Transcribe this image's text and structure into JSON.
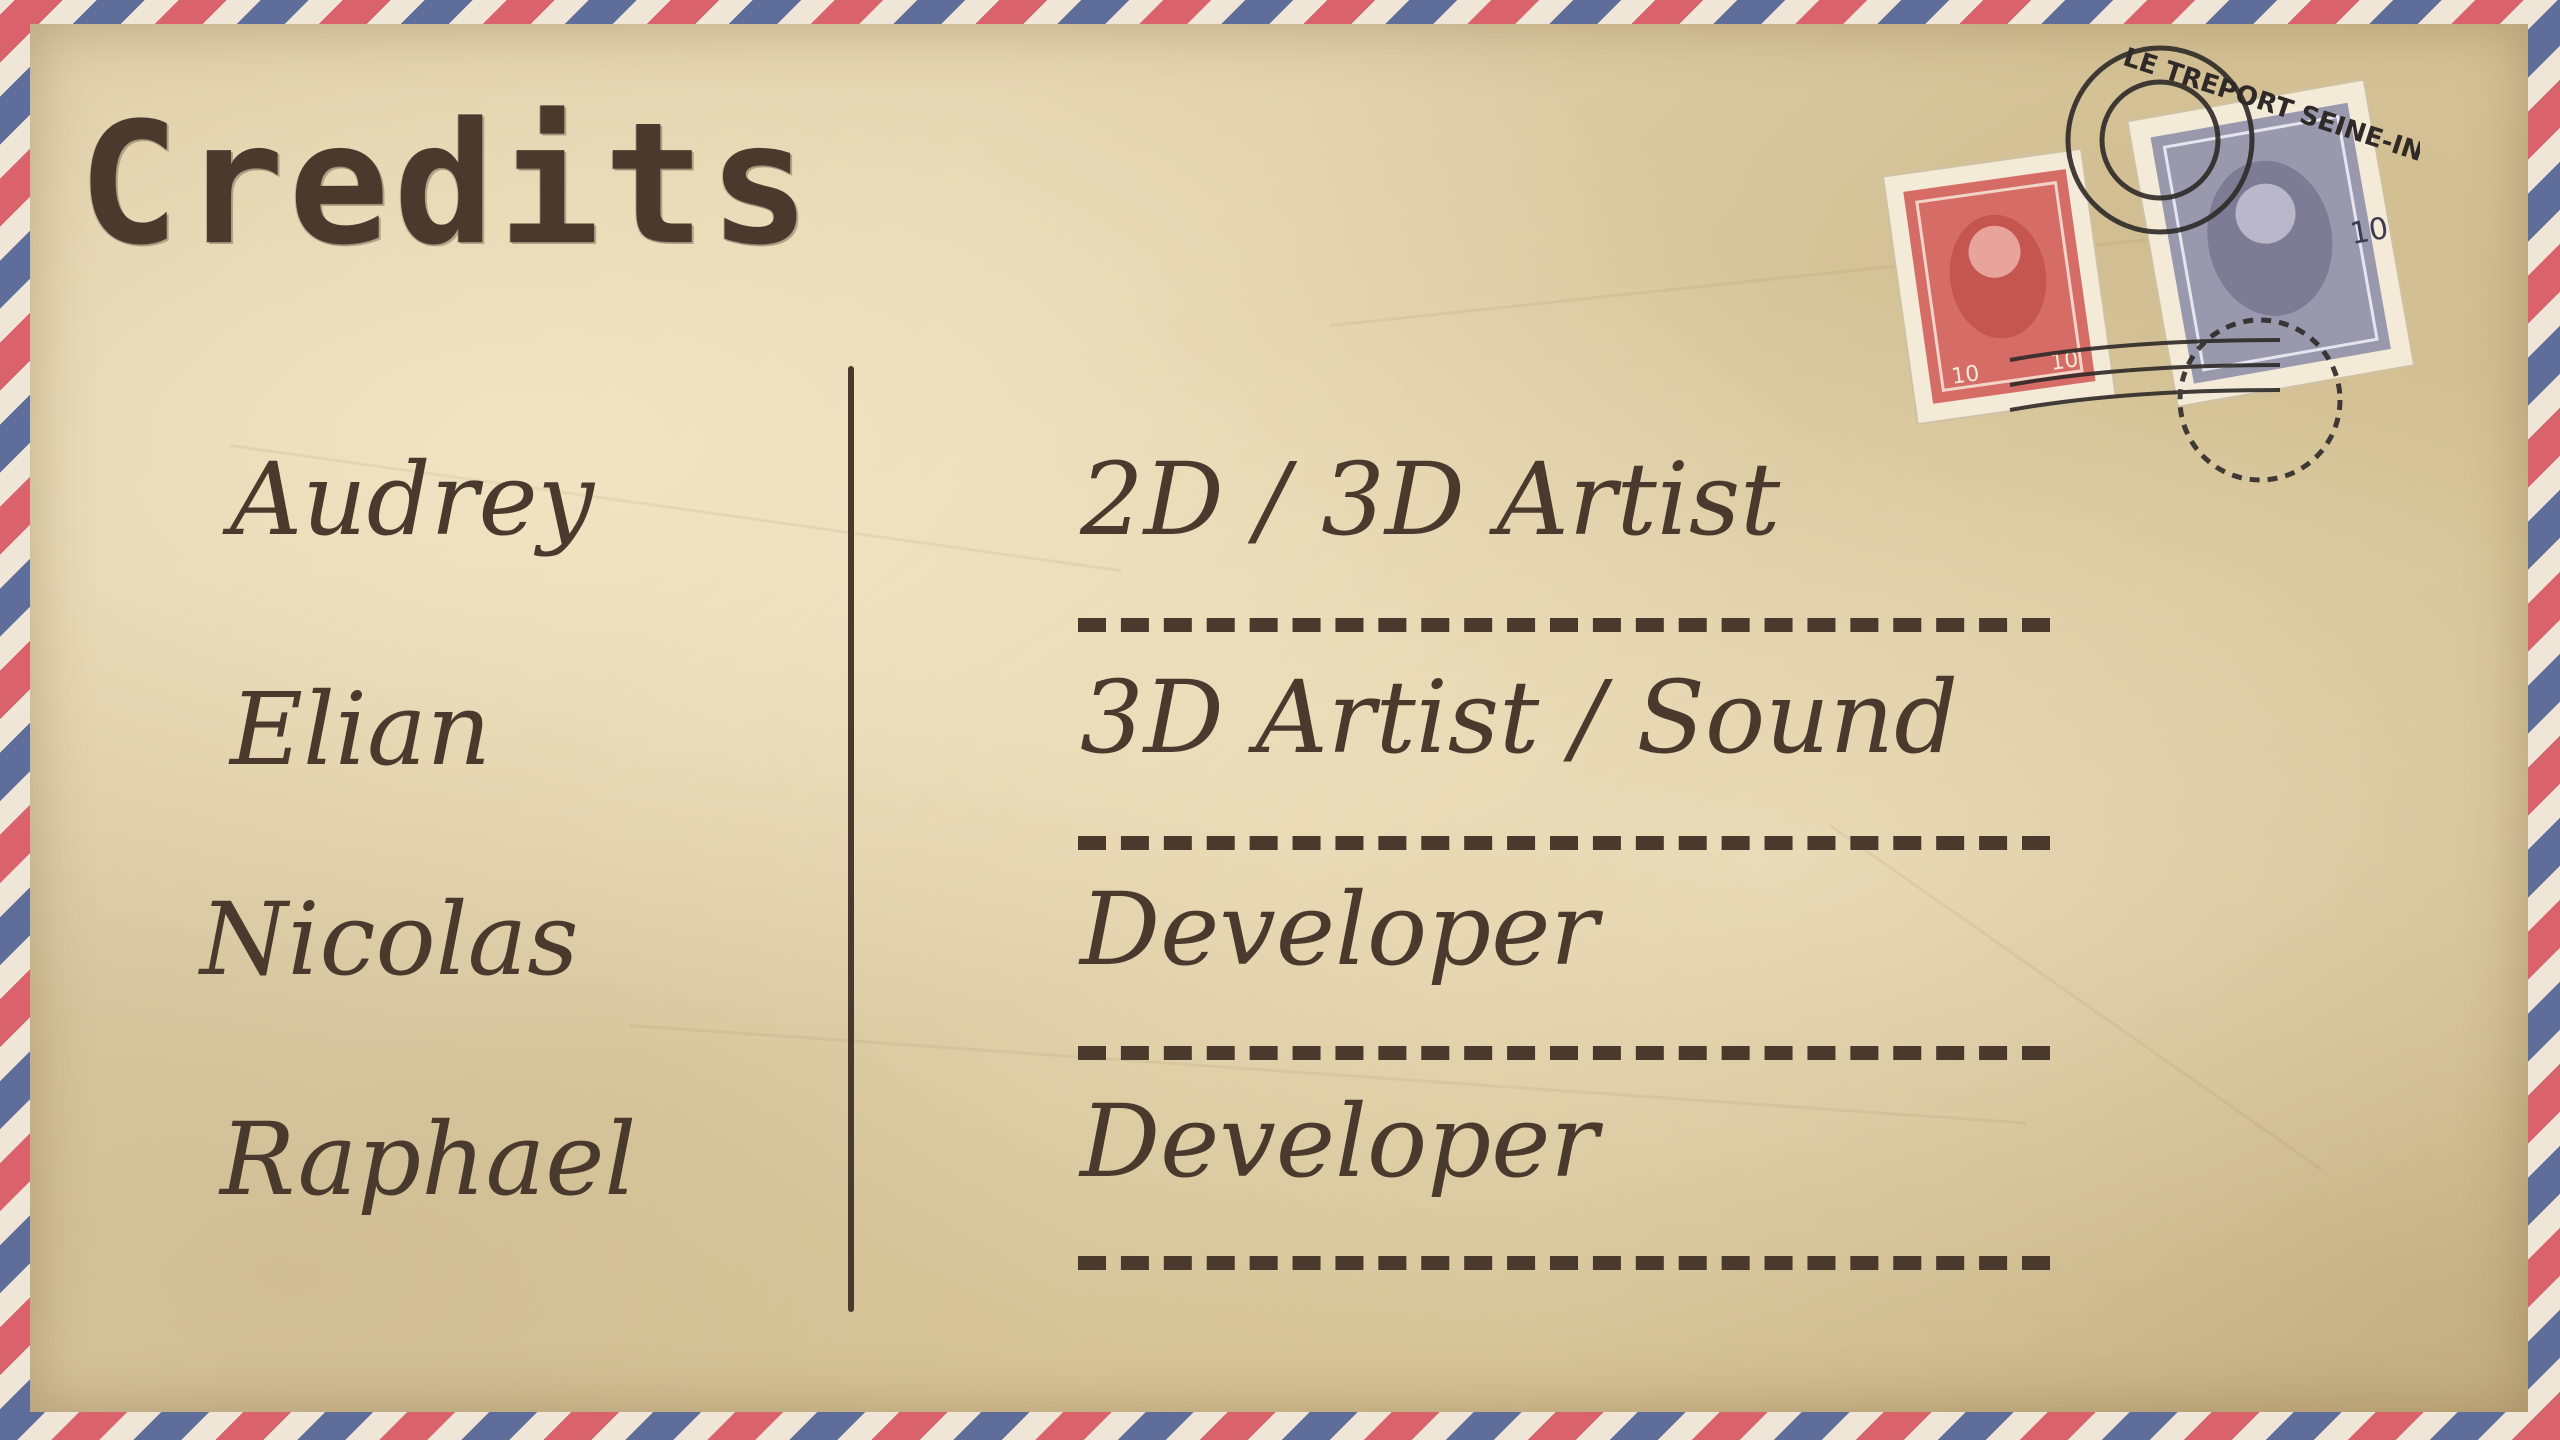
{
  "screen": {
    "title": "Credits"
  },
  "credits": [
    {
      "name": "Audrey",
      "role": "2D / 3D Artist"
    },
    {
      "name": "Elian",
      "role": "3D Artist / Sound"
    },
    {
      "name": "Nicolas",
      "role": "Developer"
    },
    {
      "name": "Raphael",
      "role": "Developer"
    }
  ],
  "postage": {
    "cancellation_text": "LE TREPORT SEINE-INF",
    "stamp1_value": "10",
    "stamp2_value": "10",
    "icons": [
      "postage-stamp-icon",
      "postmark-icon"
    ]
  },
  "colors": {
    "ink": "#4a3a2e",
    "paper": "#dccb9f",
    "stripe_red": "#d9626b",
    "stripe_blue": "#5f6d9a"
  }
}
